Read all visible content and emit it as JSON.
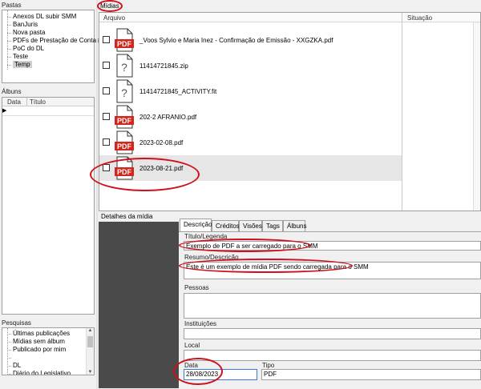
{
  "pastas": {
    "title": "Pastas",
    "items": [
      "Anexos DL subir SMM",
      "BanJuris",
      "Nova pasta",
      "PDFs de Prestação de Contas",
      "PoC do DL",
      "Teste",
      "Temp"
    ],
    "selected_index": 6
  },
  "albuns": {
    "title": "Álbuns",
    "col_data": "Data",
    "col_titulo": "Título"
  },
  "pesquisas": {
    "title": "Pesquisas",
    "items": [
      "Últimas publicações",
      "Mídias sem álbum",
      "Publicado por mim",
      "",
      "DL",
      "Diário do Legislativo"
    ]
  },
  "midias": {
    "title": "Mídias",
    "col_arquivo": "Arquivo",
    "col_situacao": "Situação",
    "files": [
      {
        "name": "_Voos Sylvio e Maria Inez - Confirmação de Emissão - XXGZKA.pdf",
        "icon": "pdf-icon"
      },
      {
        "name": "11414721845.zip",
        "icon": "unknown-file-icon"
      },
      {
        "name": "11414721845_ACTIVITY.fit",
        "icon": "unknown-file-icon"
      },
      {
        "name": "202-2 AFRANIO.pdf",
        "icon": "pdf-icon"
      },
      {
        "name": "2023-02-08.pdf",
        "icon": "pdf-icon"
      },
      {
        "name": "2023-08-21.pdf",
        "icon": "pdf-icon"
      }
    ],
    "selected_index": 5,
    "pdf_label": "PDF"
  },
  "detalhes": {
    "title": "Detalhes da mídia",
    "tabs": [
      "Descrição",
      "Créditos",
      "Visões",
      "Tags",
      "Álbuns"
    ],
    "active_tab": 0,
    "titulo_label": "Título/Legenda",
    "titulo_value": "Exemplo de PDF a ser carregado para o SMM",
    "resumo_label": "Resumo/Descrição",
    "resumo_value": "Este é um exemplo de mídia PDF sendo carregada para o SMM",
    "pessoas_label": "Pessoas",
    "instituicoes_label": "Instituições",
    "local_label": "Local",
    "data_label": "Data",
    "data_value": "28/08/2023",
    "tipo_label": "Tipo",
    "tipo_value": "PDF"
  },
  "colors": {
    "pdf_red": "#d4241c",
    "highlight_red": "#d0101a",
    "preview_bg": "#4a4a4a",
    "selected_row": "#e6e6e6"
  }
}
